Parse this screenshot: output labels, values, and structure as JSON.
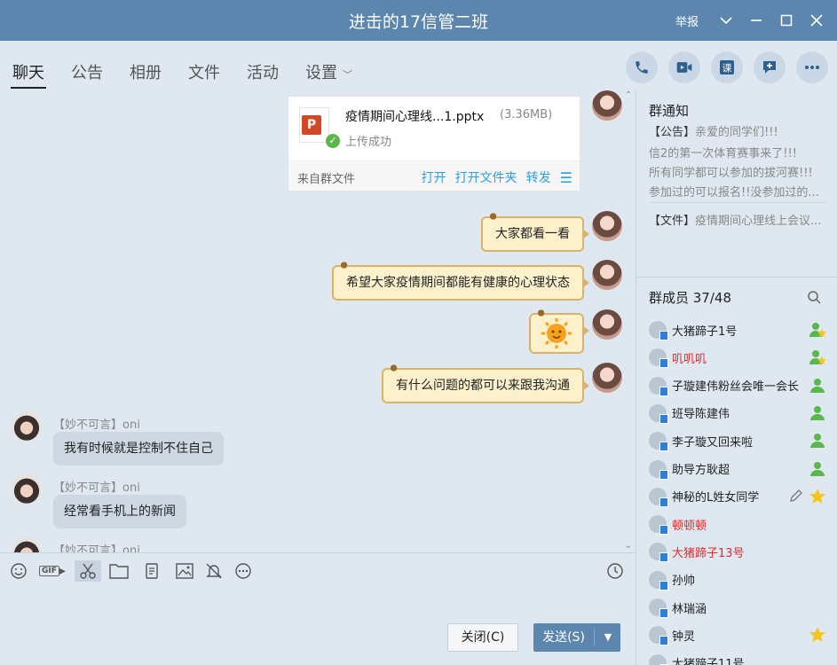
{
  "window": {
    "title": "进击的17信管二班",
    "report_label": "举报"
  },
  "tabs": [
    {
      "label": "聊天",
      "active": true
    },
    {
      "label": "公告"
    },
    {
      "label": "相册"
    },
    {
      "label": "文件"
    },
    {
      "label": "活动"
    },
    {
      "label": "设置"
    }
  ],
  "header_actions": [
    "phone-icon",
    "video-call-icon",
    "lesson-icon",
    "add-comment-icon",
    "more-icon"
  ],
  "chat": {
    "file_card": {
      "name": "疫情期间心理线...1.pptx",
      "size": "(3.36MB)",
      "status": "上传成功",
      "from": "来自群文件",
      "actions": [
        "打开",
        "打开文件夹",
        "转发"
      ]
    },
    "messages_right": [
      {
        "text": "大家都看一看"
      },
      {
        "text": "希望大家疫情期间都能有健康的心理状态"
      },
      {
        "text": "sun-emoji"
      },
      {
        "text": "有什么问题的都可以来跟我沟通"
      }
    ],
    "messages_left": [
      {
        "sender": "【妙不可言】oni",
        "text": "我有时候就是控制不住自己"
      },
      {
        "sender": "【妙不可言】oni",
        "text": "经常看手机上的新闻"
      },
      {
        "sender": "【妙不可言】oni",
        "text": ""
      }
    ]
  },
  "toolbar": {
    "tools": [
      "smile-icon",
      "gif-icon",
      "scissors-icon",
      "folder-icon",
      "shake-icon",
      "image-icon",
      "bell-off-icon",
      "more-circle-icon"
    ],
    "history_icon": "clock-icon"
  },
  "buttons": {
    "close": "关闭(C)",
    "send": "发送(S)"
  },
  "notice": {
    "title": "群通知",
    "lines": [
      {
        "tag": "【公告】",
        "text": "亲爱的同学们!!!"
      },
      {
        "tag": "",
        "text": "信2的第一次体育赛事来了!!!"
      },
      {
        "tag": "",
        "text": "所有同学都可以参加的拔河赛!!!"
      },
      {
        "tag": "",
        "text": "参加过的可以报名!!没参加过的..."
      }
    ],
    "file_line": {
      "tag": "【文件】",
      "text": "疫情期间心理线上会议..."
    }
  },
  "members": {
    "title": "群成员 37/48",
    "list": [
      {
        "name": "大猪蹄子1号",
        "red": false,
        "role": "owner"
      },
      {
        "name": "叽叽叽",
        "red": true,
        "role": "owner"
      },
      {
        "name": "子璇建伟粉丝会唯一会长",
        "red": false,
        "role": "admin"
      },
      {
        "name": "班导陈建伟",
        "red": false,
        "role": "admin"
      },
      {
        "name": "李子璇又回来啦",
        "red": false,
        "role": "admin"
      },
      {
        "name": "助导方耿超",
        "red": false,
        "role": "admin"
      },
      {
        "name": "神秘的L姓女同学",
        "red": false,
        "role": "star",
        "editable": true
      },
      {
        "name": "顿顿顿",
        "red": true,
        "role": ""
      },
      {
        "name": "大猪蹄子13号",
        "red": true,
        "role": ""
      },
      {
        "name": "孙帅",
        "red": false,
        "role": ""
      },
      {
        "name": "林瑞涵",
        "red": false,
        "role": ""
      },
      {
        "name": "钟灵",
        "red": false,
        "role": "star"
      },
      {
        "name": "大猪蹄子11号",
        "red": false,
        "role": ""
      }
    ]
  },
  "colors": {
    "titlebar": "#5c86ad",
    "background": "#dfe8f1",
    "link": "#2d9ee0",
    "highlight_name": "#e32b2b",
    "bubble_right": "#fdf1cc",
    "bubble_left": "#cdd8e3"
  }
}
